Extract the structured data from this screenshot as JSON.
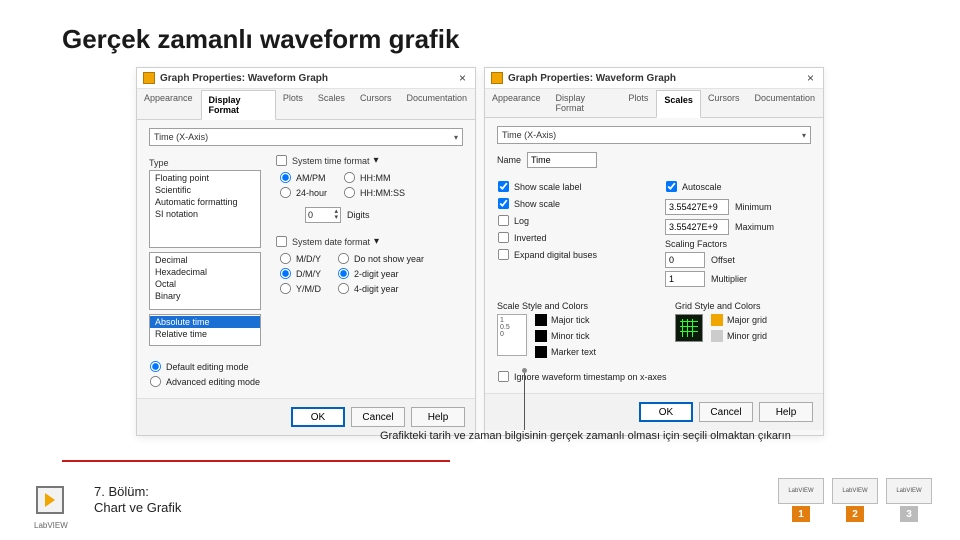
{
  "slide": {
    "title": "Gerçek zamanlı waveform grafik",
    "caption": "Grafikteki tarih ve zaman bilgisinin gerçek zamanlı olması için seçili olmaktan çıkarın",
    "chapter_line1": "7. Bölüm:",
    "chapter_line2": "Chart ve Grafik",
    "labview_label": "LabVIEW"
  },
  "dialog_left": {
    "title": "Graph Properties: Waveform Graph",
    "tabs": [
      "Appearance",
      "Display Format",
      "Plots",
      "Scales",
      "Cursors",
      "Documentation"
    ],
    "active_tab": "Display Format",
    "axis_combo": "Time (X-Axis)",
    "type_label": "Type",
    "type_options": [
      "Floating point",
      "Scientific",
      "Automatic formatting",
      "SI notation",
      "",
      "Decimal",
      "Hexadecimal",
      "Octal",
      "Binary",
      "",
      "Absolute time",
      "Relative time"
    ],
    "type_selected": "Absolute time",
    "system_time_label": "System time format",
    "time_format_options": [
      "AM/PM",
      "24-hour",
      "HH:MM",
      "HH:MM:SS"
    ],
    "digits_label": "Digits",
    "digits_value": "0",
    "system_date_label": "System date format",
    "date_format_options": [
      "M/D/Y",
      "D/M/Y",
      "Y/M/D",
      "Do not show year",
      "2-digit year",
      "4-digit year"
    ],
    "editing_mode_default": "Default editing mode",
    "editing_mode_advanced": "Advanced editing mode"
  },
  "dialog_right": {
    "title": "Graph Properties: Waveform Graph",
    "tabs": [
      "Appearance",
      "Display Format",
      "Plots",
      "Scales",
      "Cursors",
      "Documentation"
    ],
    "active_tab": "Scales",
    "axis_combo": "Time (X-Axis)",
    "name_label": "Name",
    "name_value": "Time",
    "show_scale_label": "Show scale label",
    "show_scale": "Show scale",
    "log": "Log",
    "inverted": "Inverted",
    "expand_buses": "Expand digital buses",
    "autoscale": "Autoscale",
    "minimum_label": "Minimum",
    "minimum_value": "3.55427E+9",
    "maximum_label": "Maximum",
    "maximum_value": "3.55427E+9",
    "scaling_factors": "Scaling Factors",
    "offset_label": "Offset",
    "offset_value": "0",
    "multiplier_label": "Multiplier",
    "multiplier_value": "1",
    "scale_style_label": "Scale Style and Colors",
    "major_tick": "Major tick",
    "minor_tick": "Minor tick",
    "marker_text": "Marker text",
    "grid_style_label": "Grid Style and Colors",
    "major_grid": "Major grid",
    "minor_grid": "Minor grid",
    "ignore_ts": "Ignore waveform timestamp on x-axes"
  },
  "buttons": {
    "ok": "OK",
    "cancel": "Cancel",
    "help": "Help"
  },
  "badges": {
    "lv1": "LabVIEW",
    "lv2": "LabVIEW",
    "lv3": "LabVIEW",
    "n1": "1",
    "n2": "2",
    "n3": "3"
  }
}
